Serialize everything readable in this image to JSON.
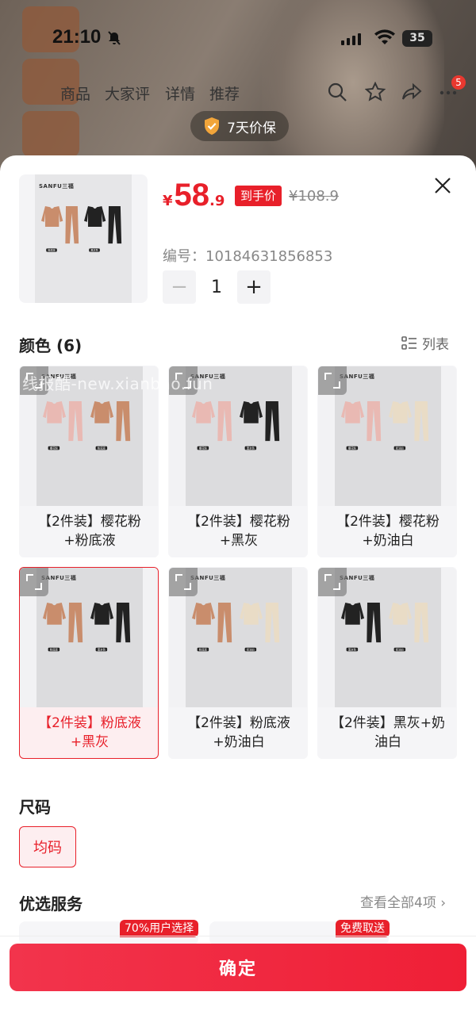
{
  "status_bar": {
    "time": "21:10",
    "battery": "35"
  },
  "top_nav": {
    "tabs": [
      "商品",
      "大家评",
      "详情",
      "推荐"
    ],
    "cart_badge": "5"
  },
  "guarantee": {
    "label": "7天价保"
  },
  "product": {
    "brand": "SANFU三福",
    "price_symbol": "¥",
    "price_int": "58",
    "price_dec": ".9",
    "price_tag": "到手价",
    "original_price": "¥108.9",
    "sku_label": "编号：10184631856853",
    "quantity": "1"
  },
  "color_section": {
    "title": "颜色 (6)",
    "list_view_label": "列表",
    "watermark": "线报酷-new.xianbao.fun",
    "options": [
      {
        "line1": "【2件装】樱花粉",
        "line2": "+粉底液",
        "c1": "#e9b9b3",
        "c2": "#c98d6c",
        "tag1": "樱花粉",
        "tag2": "粉底液",
        "selected": false
      },
      {
        "line1": "【2件装】樱花粉",
        "line2": "+黑灰",
        "c1": "#e9b9b3",
        "c2": "#222222",
        "tag1": "樱花粉",
        "tag2": "黑灰色",
        "selected": false
      },
      {
        "line1": "【2件装】樱花粉",
        "line2": "+奶油白",
        "c1": "#e9b9b3",
        "c2": "#e9dcc6",
        "tag1": "樱花粉",
        "tag2": "奶油白",
        "selected": false
      },
      {
        "line1": "【2件装】粉底液",
        "line2": "+黑灰",
        "c1": "#c98d6c",
        "c2": "#222222",
        "tag1": "粉底液",
        "tag2": "黑灰色",
        "selected": true
      },
      {
        "line1": "【2件装】粉底液",
        "line2": "+奶油白",
        "c1": "#c98d6c",
        "c2": "#e9dcc6",
        "tag1": "粉底液",
        "tag2": "奶油白",
        "selected": false
      },
      {
        "line1": "【2件装】黑灰+奶",
        "line2": "油白",
        "c1": "#222222",
        "c2": "#e9dcc6",
        "tag1": "黑灰色",
        "tag2": "奶油白",
        "selected": false
      }
    ]
  },
  "product_image": {
    "c1": "#c98d6c",
    "c2": "#222222",
    "tag1": "粉底液",
    "tag2": "黑灰色"
  },
  "size_section": {
    "title": "尺码",
    "option": "均码"
  },
  "service_section": {
    "title": "优选服务",
    "view_all": "查看全部4项 ›",
    "tag1": "70%用户选择",
    "tag2": "免费取送"
  },
  "confirm_button": "确定",
  "colors": {
    "accent": "#e8202a"
  }
}
